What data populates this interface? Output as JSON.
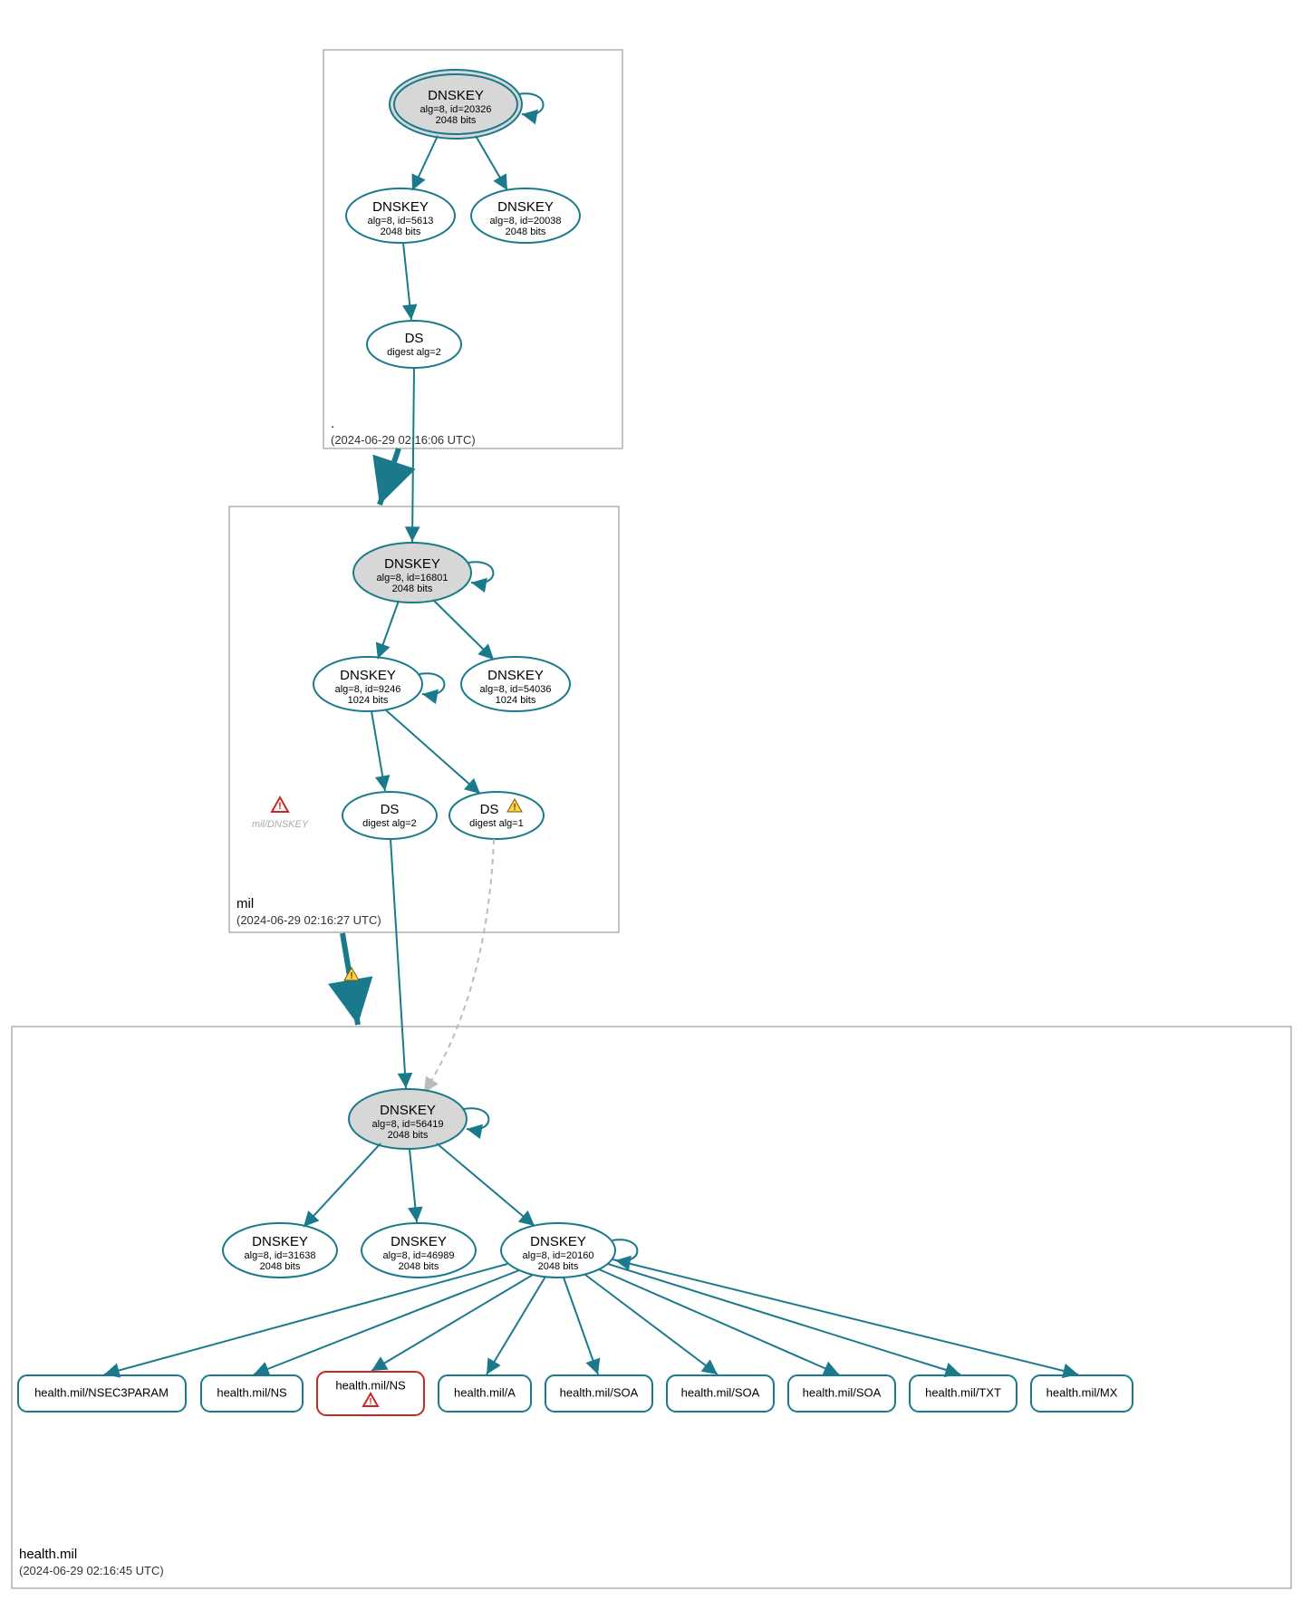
{
  "zones": {
    "root": {
      "name": ".",
      "timestamp": "(2024-06-29 02:16:06 UTC)"
    },
    "mil": {
      "name": "mil",
      "timestamp": "(2024-06-29 02:16:27 UTC)"
    },
    "health": {
      "name": "health.mil",
      "timestamp": "(2024-06-29 02:16:45 UTC)"
    }
  },
  "nodes": {
    "root_ksk": {
      "title": "DNSKEY",
      "line1": "alg=8, id=20326",
      "line2": "2048 bits"
    },
    "root_zsk1": {
      "title": "DNSKEY",
      "line1": "alg=8, id=5613",
      "line2": "2048 bits"
    },
    "root_zsk2": {
      "title": "DNSKEY",
      "line1": "alg=8, id=20038",
      "line2": "2048 bits"
    },
    "root_ds": {
      "title": "DS",
      "line1": "digest alg=2"
    },
    "mil_ksk": {
      "title": "DNSKEY",
      "line1": "alg=8, id=16801",
      "line2": "2048 bits"
    },
    "mil_zsk1": {
      "title": "DNSKEY",
      "line1": "alg=8, id=9246",
      "line2": "1024 bits"
    },
    "mil_zsk2": {
      "title": "DNSKEY",
      "line1": "alg=8, id=54036",
      "line2": "1024 bits"
    },
    "mil_missing": {
      "label": "mil/DNSKEY"
    },
    "mil_ds1": {
      "title": "DS",
      "line1": "digest alg=2"
    },
    "mil_ds2": {
      "title": "DS",
      "line1": "digest alg=1"
    },
    "h_ksk": {
      "title": "DNSKEY",
      "line1": "alg=8, id=56419",
      "line2": "2048 bits"
    },
    "h_zsk1": {
      "title": "DNSKEY",
      "line1": "alg=8, id=31638",
      "line2": "2048 bits"
    },
    "h_zsk2": {
      "title": "DNSKEY",
      "line1": "alg=8, id=46989",
      "line2": "2048 bits"
    },
    "h_zsk3": {
      "title": "DNSKEY",
      "line1": "alg=8, id=20160",
      "line2": "2048 bits"
    }
  },
  "rrsets": {
    "r1": "health.mil/NSEC3PARAM",
    "r2": "health.mil/NS",
    "r3": "health.mil/NS",
    "r4": "health.mil/A",
    "r5": "health.mil/SOA",
    "r6": "health.mil/SOA",
    "r7": "health.mil/SOA",
    "r8": "health.mil/TXT",
    "r9": "health.mil/MX"
  }
}
